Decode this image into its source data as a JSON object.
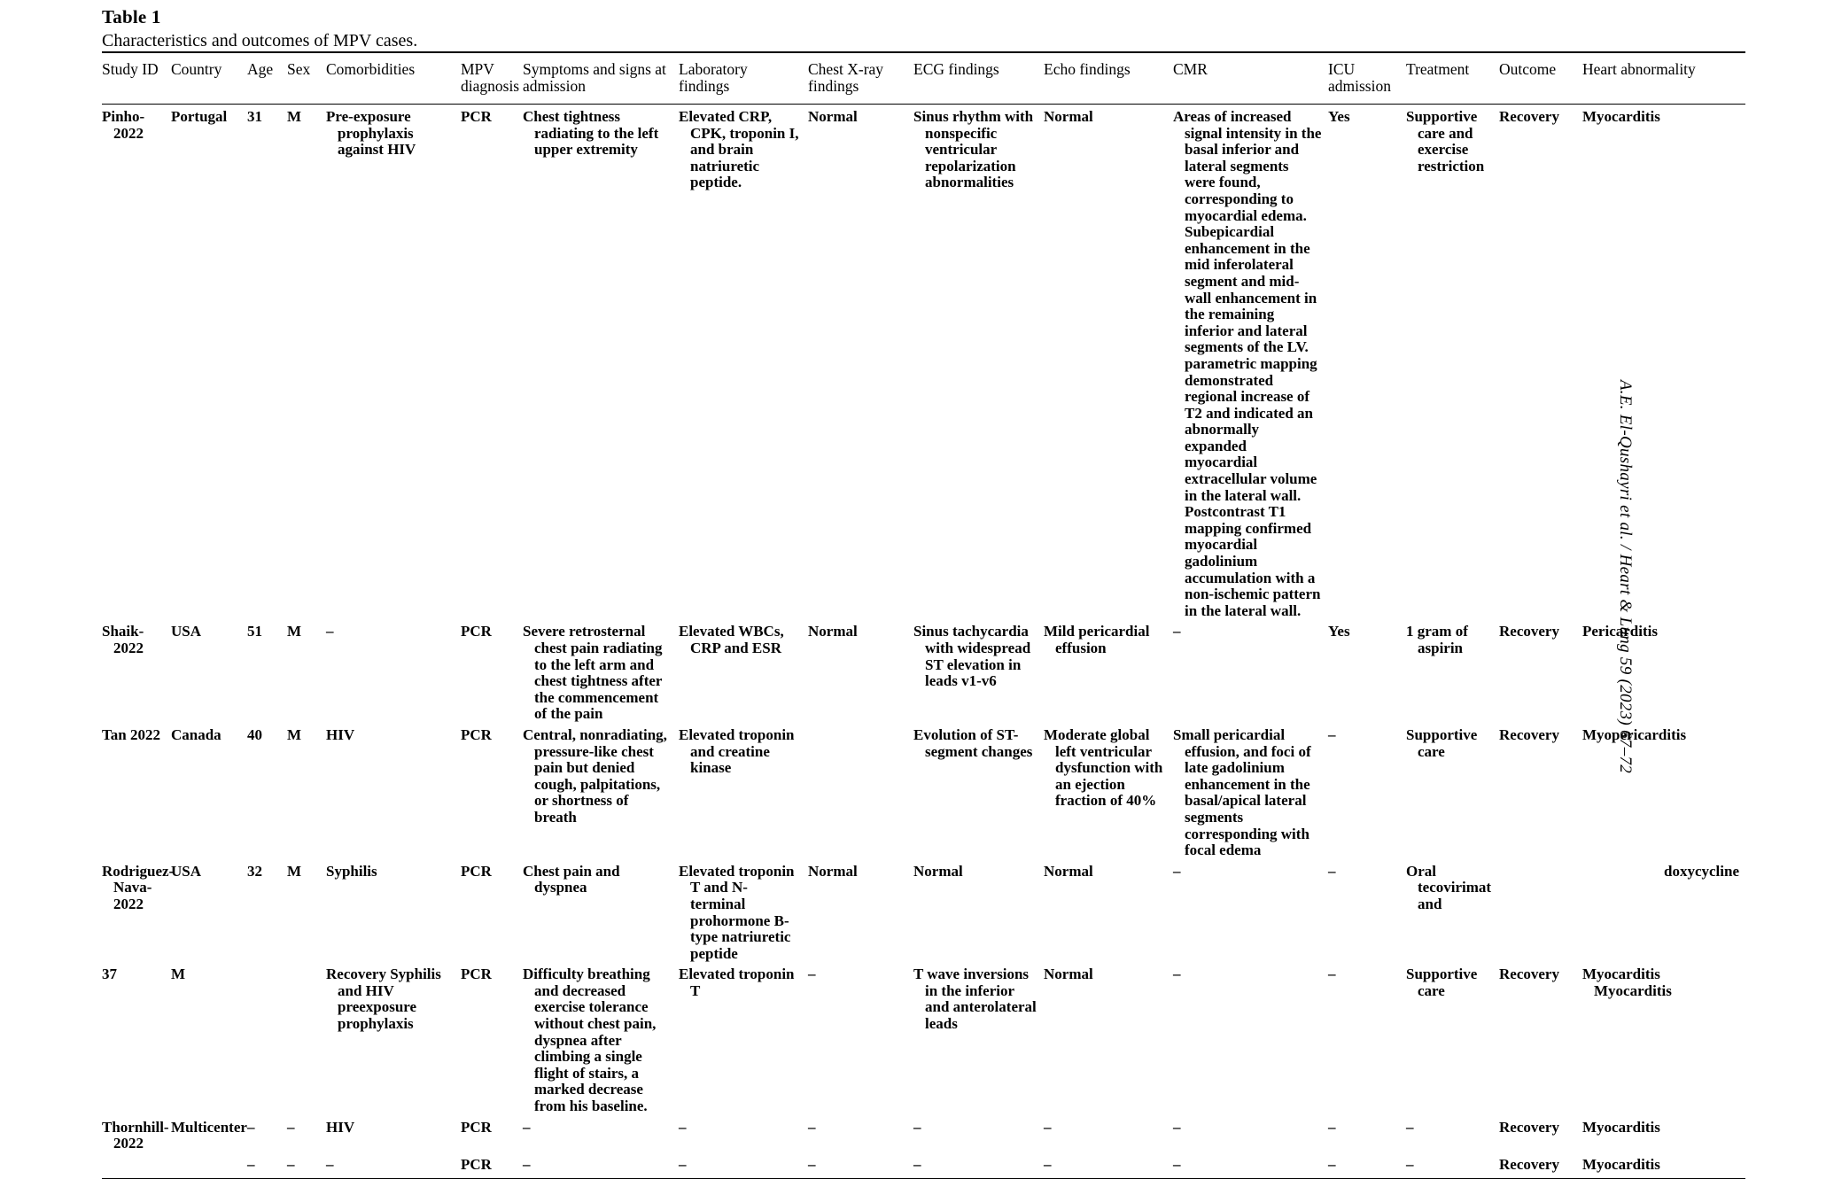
{
  "caption": {
    "label": "Table 1",
    "text": "Characteristics and outcomes of MPV cases."
  },
  "running_head": "A.E. El-Qushayri et al. / Heart & Lung 59 (2023) 67‒72",
  "table": {
    "columns": [
      {
        "key": "study_id",
        "header": "Study ID"
      },
      {
        "key": "country",
        "header": "Country"
      },
      {
        "key": "age",
        "header": "Age"
      },
      {
        "key": "sex",
        "header": "Sex"
      },
      {
        "key": "comorbid",
        "header": "Comorbidities"
      },
      {
        "key": "mpv",
        "header": "MPV diagnosis"
      },
      {
        "key": "symptoms",
        "header": "Symptoms and signs at admission"
      },
      {
        "key": "lab",
        "header": "Laboratory findings"
      },
      {
        "key": "cxr",
        "header": "Chest X-ray findings"
      },
      {
        "key": "ecg",
        "header": "ECG findings"
      },
      {
        "key": "echo",
        "header": "Echo findings"
      },
      {
        "key": "cmr",
        "header": "CMR"
      },
      {
        "key": "icu",
        "header": "ICU admission"
      },
      {
        "key": "treatment",
        "header": "Treatment"
      },
      {
        "key": "outcome",
        "header": "Outcome"
      },
      {
        "key": "heart",
        "header": "Heart abnormality"
      }
    ],
    "rows": [
      {
        "study_id": "Pinho-2022",
        "country": "Portugal",
        "age": "31",
        "sex": "M",
        "comorbid": "Pre-exposure prophylaxis against HIV",
        "mpv": "PCR",
        "symptoms": "Chest tightness radiating to the left upper extremity",
        "lab": "Elevated CRP, CPK, troponin I, and brain natriuretic peptide.",
        "cxr": "Normal",
        "ecg": "Sinus rhythm with nonspecific ventricular repolarization abnormalities",
        "echo": "Normal",
        "cmr": "Areas of increased signal intensity in the basal inferior and lateral segments were found, corresponding to myocardial edema. Subepicardial enhancement in the mid inferolateral segment and mid-wall enhancement in the remaining inferior and lateral segments of the LV. parametric mapping demonstrated regional increase of T2 and indicated an abnormally expanded myocardial extracellular volume in the lateral wall. Postcontrast T1 mapping confirmed myocardial gadolinium accumulation with a non-ischemic pattern in the lateral wall.",
        "icu": "Yes",
        "treatment": "Supportive care and exercise restriction",
        "outcome": "Recovery",
        "heart": "Myocarditis"
      },
      {
        "study_id": "Shaik-2022",
        "country": "USA",
        "age": "51",
        "sex": "M",
        "comorbid": "–",
        "mpv": "PCR",
        "symptoms": "Severe retrosternal chest pain radiating to the left arm and chest tightness after the commencement of the pain",
        "lab": "Elevated WBCs, CRP and ESR",
        "cxr": "Normal",
        "ecg": "Sinus tachycardia with widespread ST elevation in leads v1-v6",
        "echo": "Mild pericardial effusion",
        "cmr": "–",
        "icu": "Yes",
        "treatment": "1 gram of aspirin",
        "outcome": "Recovery",
        "heart": "Pericarditis"
      },
      {
        "study_id": "Tan 2022",
        "country": "Canada",
        "age": "40",
        "sex": "M",
        "comorbid": "HIV",
        "mpv": "PCR",
        "symptoms": "Central, nonradiating, pressure-like chest pain but denied cough, palpitations, or shortness of breath",
        "lab": "Elevated troponin and creatine kinase",
        "cxr": "",
        "ecg": "Evolution of ST-segment changes",
        "echo": "Moderate global left ventricular dysfunction with an ejection fraction of 40%",
        "cmr": "Small pericardial effusion, and foci of late gadolinium enhancement in the basal/apical lateral segments corresponding with focal edema",
        "icu": "–",
        "treatment": "Supportive care",
        "outcome": "Recovery",
        "heart": "Myopericarditis"
      },
      {
        "study_id": "Rodriguez-Nava-2022",
        "country": "USA",
        "age": "32",
        "sex": "M",
        "comorbid": "Syphilis",
        "mpv": "PCR",
        "symptoms": "Chest pain and dyspnea",
        "lab": "Elevated troponin T and N-terminal prohormone B-type natriuretic peptide",
        "cxr": "Normal",
        "ecg": "Normal",
        "echo": "Normal",
        "cmr": "–",
        "icu": "–",
        "treatment": "Oral tecovirimat and",
        "outcome": "",
        "heart": "doxycycline"
      },
      {
        "study_id": "37",
        "country": "M",
        "age": "",
        "sex": "",
        "comorbid": "Recovery Syphilis and HIV preexposure prophylaxis",
        "mpv": "PCR",
        "symptoms": "Difficulty breathing and decreased exercise tolerance without chest pain, dyspnea after climbing a single flight of stairs, a marked decrease from his baseline.",
        "lab": "Elevated troponin T",
        "cxr": "–",
        "ecg": "T wave inversions in the inferior and anterolateral leads",
        "echo": "Normal",
        "cmr": "–",
        "icu": "–",
        "treatment": "Supportive care",
        "outcome": "Recovery",
        "heart": "Myocarditis Myocarditis"
      },
      {
        "study_id": "Thornhill-2022",
        "country": "Multicenter",
        "age": "–",
        "sex": "–",
        "comorbid": "HIV",
        "mpv": "PCR",
        "symptoms": "–",
        "lab": "–",
        "cxr": "–",
        "ecg": "–",
        "echo": "–",
        "cmr": "–",
        "icu": "–",
        "treatment": "–",
        "outcome": "Recovery",
        "heart": "Myocarditis"
      },
      {
        "study_id": "",
        "country": "",
        "age": "–",
        "sex": "–",
        "comorbid": "–",
        "mpv": "PCR",
        "symptoms": "–",
        "lab": "–",
        "cxr": "–",
        "ecg": "–",
        "echo": "–",
        "cmr": "–",
        "icu": "–",
        "treatment": "–",
        "outcome": "Recovery",
        "heart": "Myocarditis"
      }
    ]
  }
}
